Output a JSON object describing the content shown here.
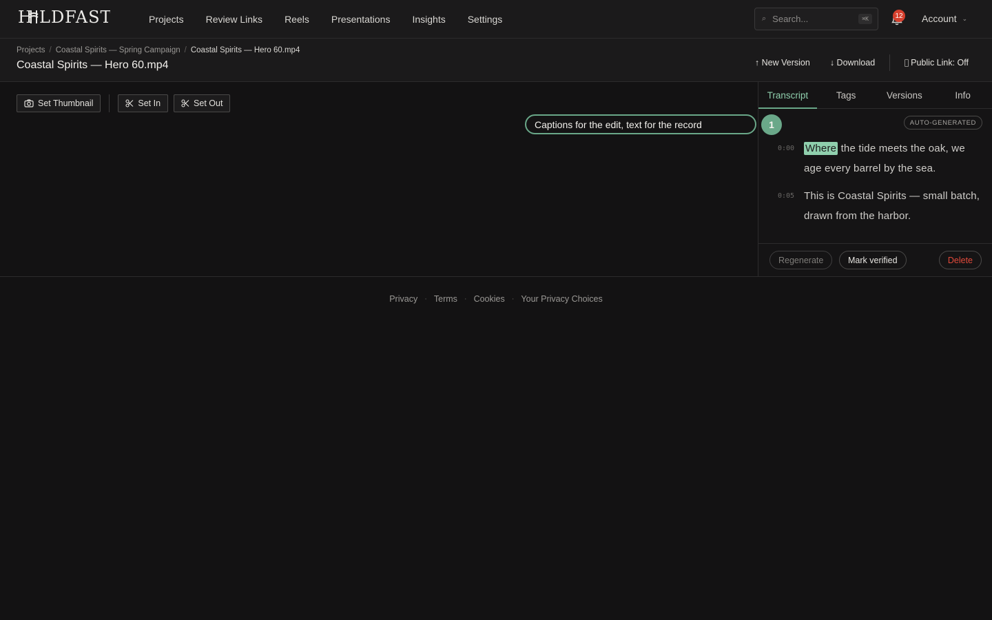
{
  "brand": {
    "logo_text": "HOLDFAST"
  },
  "nav": {
    "items": [
      {
        "label": "Projects"
      },
      {
        "label": "Review Links"
      },
      {
        "label": "Reels"
      },
      {
        "label": "Presentations"
      },
      {
        "label": "Insights"
      },
      {
        "label": "Settings"
      }
    ]
  },
  "search": {
    "placeholder": "Search...",
    "shortcut": "⌘K",
    "icon": "search-icon"
  },
  "notifications": {
    "count": "12",
    "icon": "bell-icon"
  },
  "account": {
    "label": "Account",
    "icon": "chevron-down-icon"
  },
  "breadcrumb": {
    "items": [
      "Projects",
      "Coastal Spirits — Spring Campaign",
      "Coastal Spirits — Hero 60.mp4"
    ]
  },
  "page": {
    "title": "Coastal Spirits — Hero 60.mp4"
  },
  "header_actions": {
    "new_version": "↑ New Version",
    "download": "↓ Download",
    "public_link": "Public Link: Off"
  },
  "toolbar": {
    "set_thumbnail": "Set Thumbnail",
    "set_in": "Set In",
    "set_out": "Set Out"
  },
  "callout": {
    "text": "Captions for the edit, text for the record",
    "number": "1"
  },
  "panel": {
    "tabs": [
      {
        "label": "Transcript",
        "active": true
      },
      {
        "label": "Tags"
      },
      {
        "label": "Versions"
      },
      {
        "label": "Info"
      }
    ],
    "badge": "AUTO-GENERATED",
    "transcript": [
      {
        "time": "0:00",
        "highlight": "Where",
        "rest": "the tide meets the oak, we age every barrel by the sea."
      },
      {
        "time": "0:05",
        "text": "This is Coastal Spirits — small batch, drawn from the harbor."
      }
    ],
    "actions": {
      "regenerate": "Regenerate",
      "mark_verified": "Mark verified",
      "delete": "Delete"
    }
  },
  "footer": {
    "links": [
      "Privacy",
      "Terms",
      "Cookies",
      "Your Privacy Choices"
    ]
  },
  "colors": {
    "accent": "#6aa889",
    "highlight": "#8fcfad",
    "danger": "#e24a3b",
    "badge": "#d6402e"
  }
}
